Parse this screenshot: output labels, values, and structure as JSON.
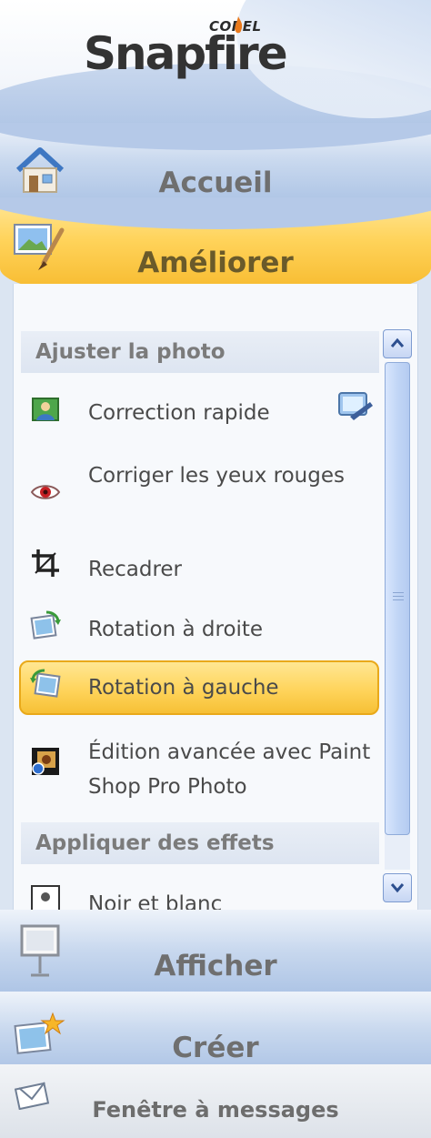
{
  "header": {
    "brand_small": "COREL",
    "brand_main": "Snapfire"
  },
  "nav": {
    "accueil": "Accueil",
    "ameliorer": "Améliorer",
    "afficher": "Afficher",
    "creer": "Créer",
    "messages": "Fenêtre à messages"
  },
  "panel": {
    "section1": "Ajuster la photo",
    "items": [
      {
        "label": "Correction rapide"
      },
      {
        "label": "Corriger les yeux rouges"
      },
      {
        "label": "Recadrer"
      },
      {
        "label": "Rotation à droite"
      },
      {
        "label": "Rotation à gauche"
      },
      {
        "label": "Édition avancée avec Paint Shop Pro Photo"
      }
    ],
    "section2": "Appliquer des effets",
    "partial_item": "Noir et blanc"
  },
  "colors": {
    "accent_orange": "#f6c035",
    "nav_blue": "#a9c1e4",
    "text_gray": "#6f6f6f"
  }
}
